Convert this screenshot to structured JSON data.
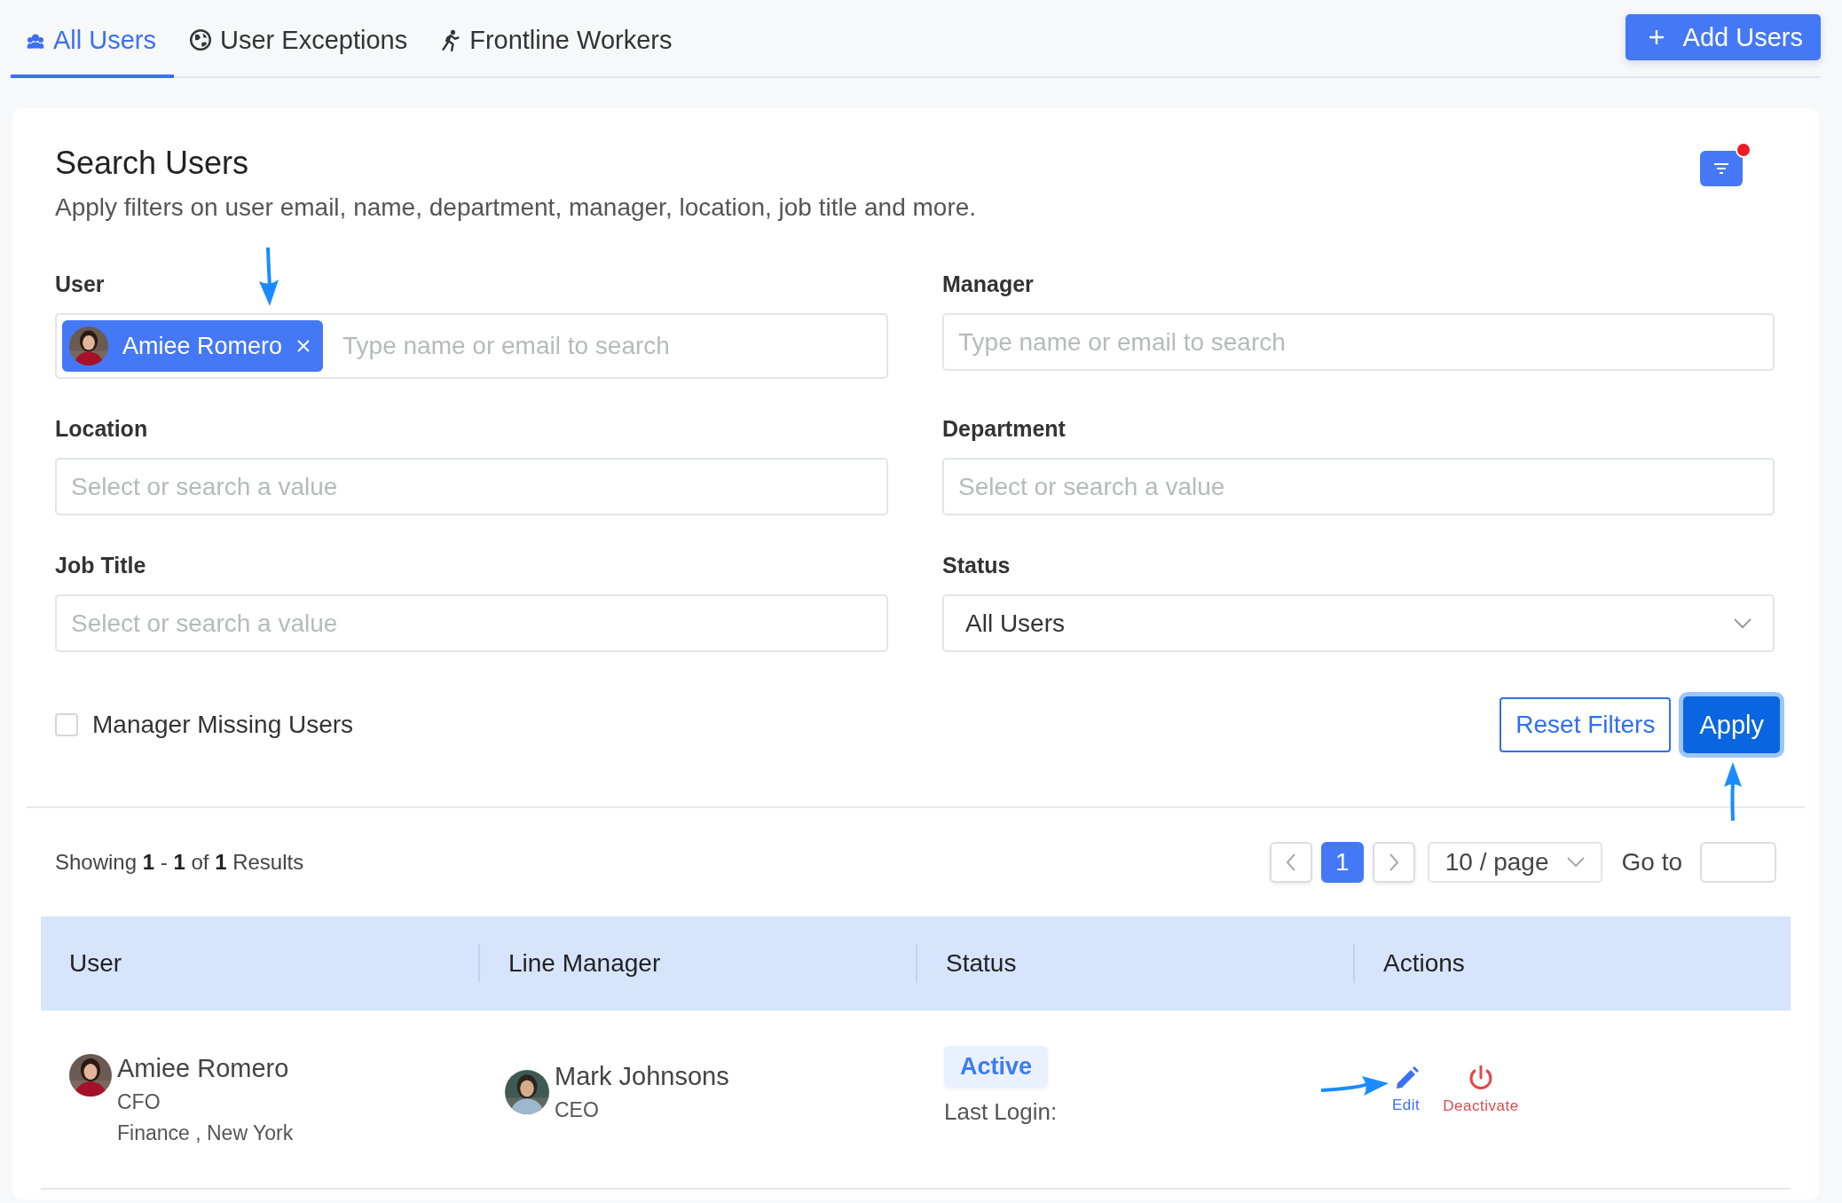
{
  "tabs": [
    {
      "label": "All Users",
      "selected": true
    },
    {
      "label": "User Exceptions",
      "selected": false
    },
    {
      "label": "Frontline Workers",
      "selected": false
    }
  ],
  "add_button": {
    "label": "Add Users"
  },
  "search": {
    "title": "Search Users",
    "subtitle": "Apply filters on user email, name, department, manager, location, job title and more.",
    "filter_button": {
      "badge": true
    },
    "filters": [
      {
        "label": "User",
        "kind": "tags",
        "tags": [
          {
            "name": "Amiee Romero"
          }
        ],
        "placeholder": "Type name or email to search"
      },
      {
        "label": "Manager",
        "kind": "text",
        "placeholder": "Type name or email to search"
      },
      {
        "label": "Location",
        "kind": "text",
        "placeholder": "Select or search a value"
      },
      {
        "label": "Department",
        "kind": "text",
        "placeholder": "Select or search a value"
      },
      {
        "label": "Job Title",
        "kind": "text",
        "placeholder": "Select or search a value"
      },
      {
        "label": "Status",
        "kind": "select",
        "value": "All Users"
      }
    ],
    "checkbox": {
      "label": "Manager Missing Users",
      "checked": false
    },
    "reset_button": "Reset Filters",
    "apply_button": "Apply"
  },
  "results": {
    "summary": "Showing **1** - **1** of **1** Results",
    "pages": [
      {
        "label": "1",
        "selected": true
      }
    ],
    "page_size": "10 / page",
    "goto_label": "Go to"
  },
  "table": {
    "columns": [
      "User",
      "Line Manager",
      "Status",
      "Actions"
    ],
    "rows": [
      {
        "user": {
          "name": "Amiee Romero",
          "title": "CFO",
          "details": "Finance , New York"
        },
        "manager": {
          "name": "Mark Johnsons",
          "title": "CEO"
        },
        "status": {
          "badge": "Active",
          "last_login": "Last Login:"
        },
        "actions": [
          {
            "label": "Edit",
            "kind": "edit"
          },
          {
            "label": "Deactivate",
            "kind": "deactivate"
          }
        ]
      }
    ]
  }
}
